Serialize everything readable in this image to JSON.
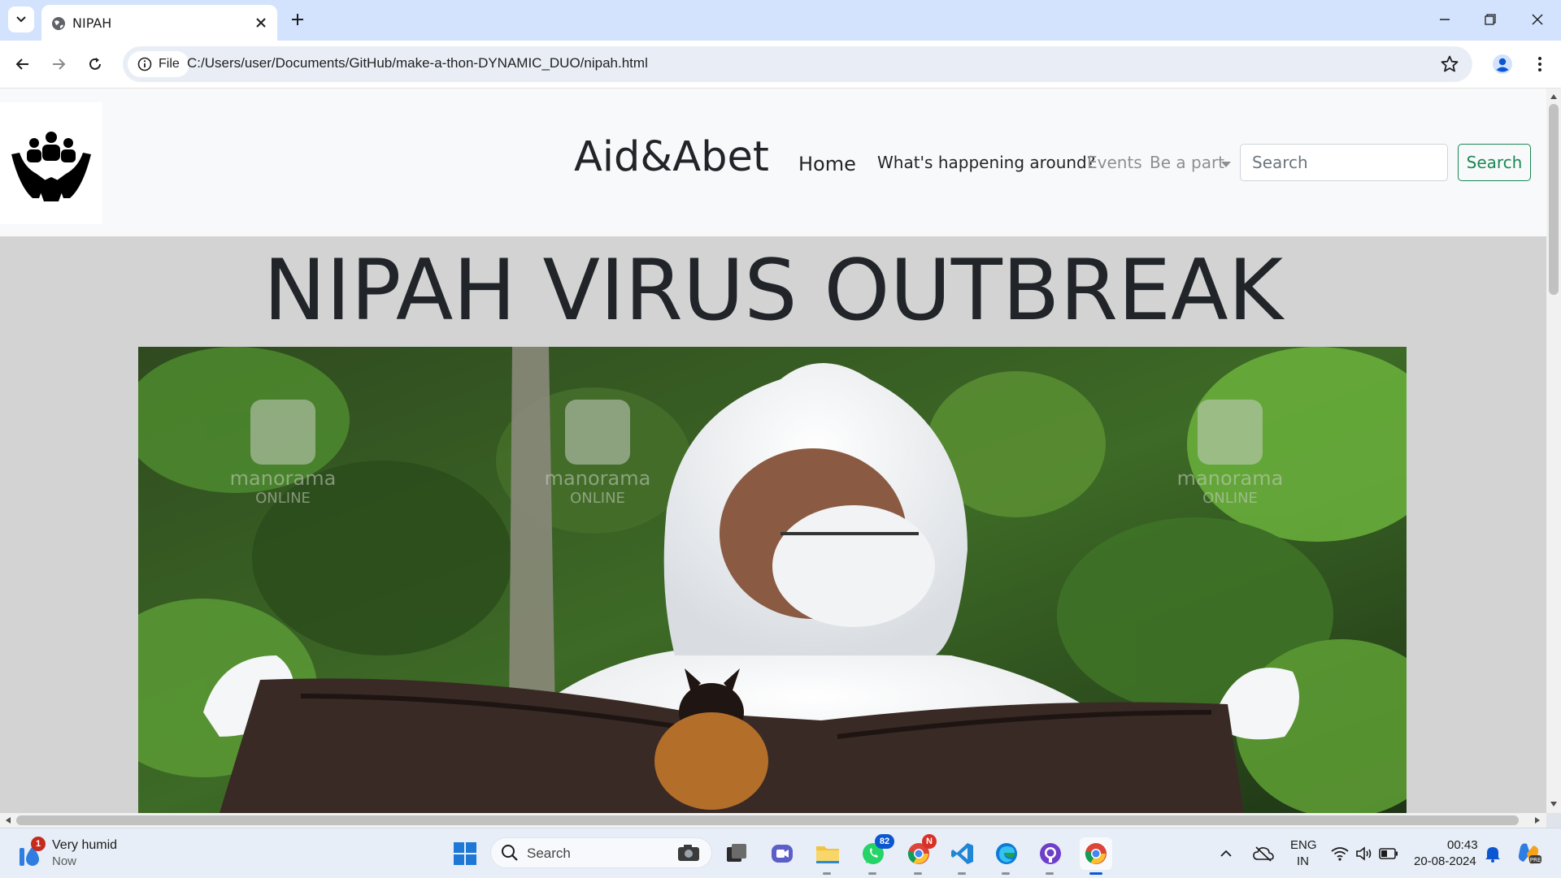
{
  "browser": {
    "tab_title": "NIPAH",
    "url_chip_label": "File",
    "url": "C:/Users/user/Documents/GitHub/make-a-thon-DYNAMIC_DUO/nipah.html"
  },
  "site": {
    "brand": "Aid&Abet",
    "nav": {
      "home": "Home",
      "happening": "What's happening around?",
      "events": "Events",
      "be_a_part": "Be a part"
    },
    "search": {
      "placeholder": "Search",
      "button_label": "Search"
    },
    "heading": "NIPAH VIRUS OUTBREAK",
    "hero_watermark": {
      "brand": "manorama",
      "sub": "ONLINE"
    }
  },
  "taskbar": {
    "weather_condition": "Very humid",
    "weather_time": "Now",
    "weather_badge": "1",
    "search_label": "Search",
    "whatsapp_badge": "82",
    "chrome_badge": "N",
    "lang_line1": "ENG",
    "lang_line2": "IN",
    "clock_time": "00:43",
    "clock_date": "20-08-2024"
  }
}
